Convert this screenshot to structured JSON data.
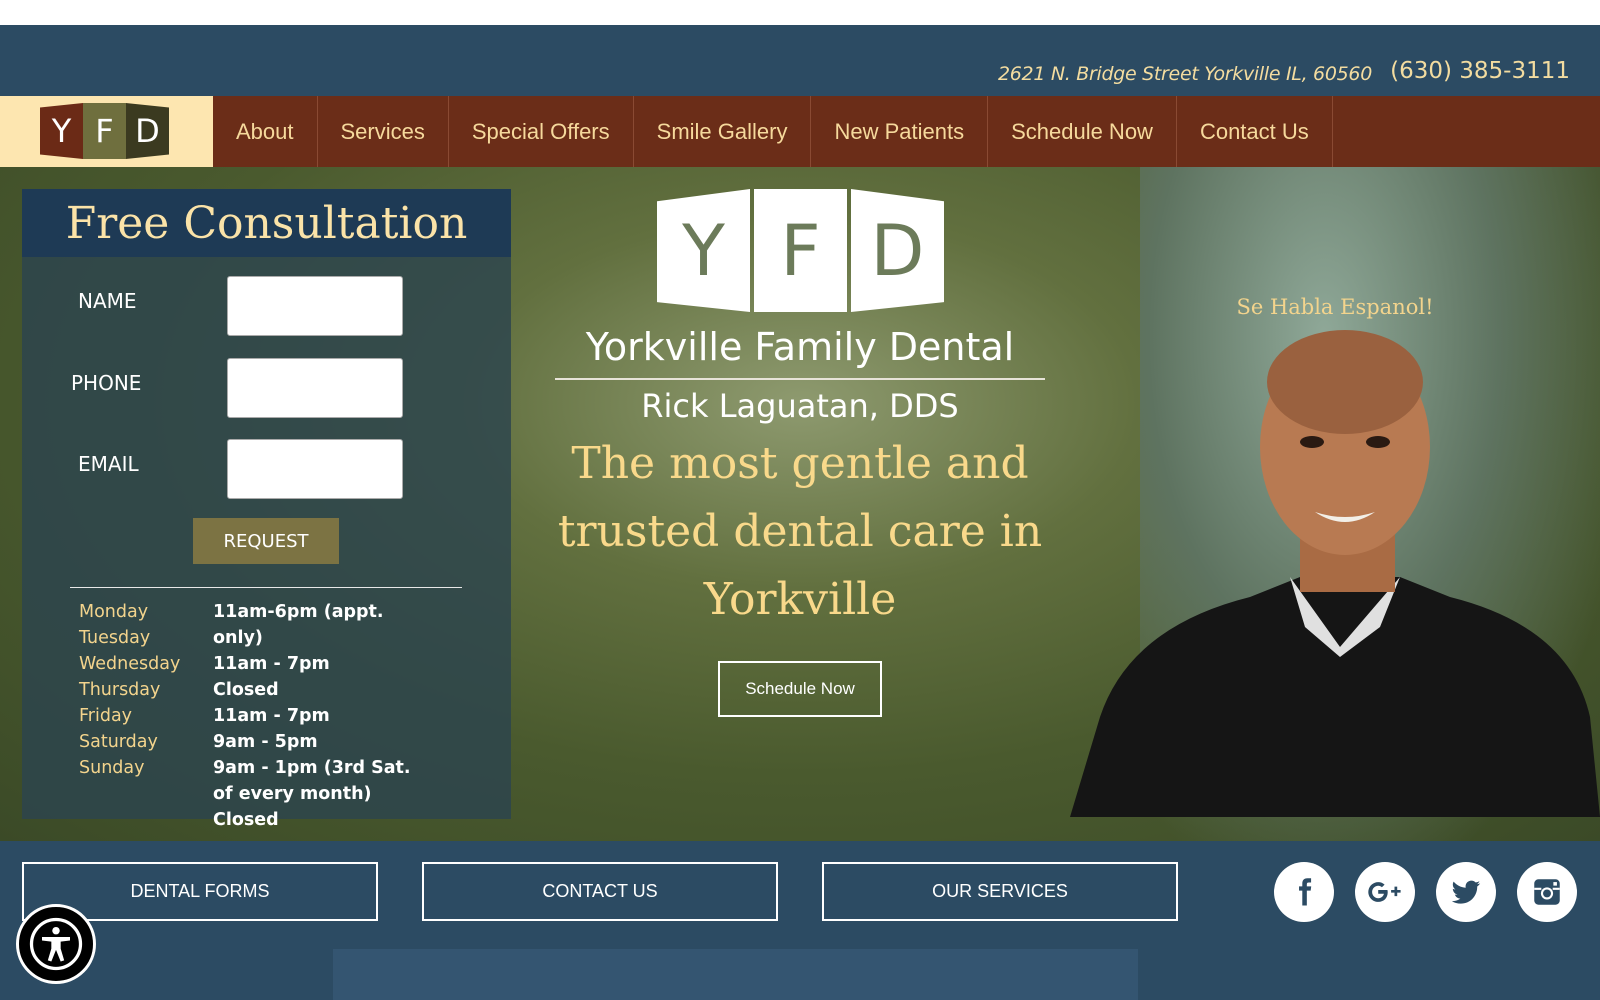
{
  "header": {
    "address": "2621 N. Bridge Street Yorkville IL, 60560",
    "phone": "(630) 385-3111"
  },
  "logo": {
    "letters": [
      "Y",
      "F",
      "D"
    ]
  },
  "nav": {
    "items": [
      {
        "label": "About"
      },
      {
        "label": "Services"
      },
      {
        "label": "Special Offers"
      },
      {
        "label": "Smile Gallery"
      },
      {
        "label": "New Patients"
      },
      {
        "label": "Schedule Now"
      },
      {
        "label": "Contact Us"
      }
    ]
  },
  "form": {
    "title": "Free Consultation",
    "name_label": "NAME",
    "phone_label": "PHONE",
    "email_label": "EMAIL",
    "name_value": "",
    "phone_value": "",
    "email_value": "",
    "submit_label": "REQUEST"
  },
  "hours": {
    "days": [
      "Monday",
      "Tuesday",
      "Wednesday",
      "Thursday",
      "Friday",
      "Saturday",
      "Sunday"
    ],
    "times": [
      "11am-6pm (appt. only)",
      "11am - 7pm",
      "Closed",
      "11am - 7pm",
      "9am - 5pm",
      "9am - 1pm (3rd Sat. of every month)",
      "Closed"
    ]
  },
  "hero": {
    "brand_letters": [
      "Y",
      "F",
      "D"
    ],
    "brand_name": "Yorkville Family Dental",
    "doctor": "Rick Laguatan, DDS",
    "tagline": "The most gentle and trusted dental care in Yorkville",
    "cta_label": "Schedule Now",
    "spanish_note": "Se Habla Espanol!"
  },
  "footer": {
    "buttons": [
      {
        "label": "DENTAL FORMS"
      },
      {
        "label": "CONTACT US"
      },
      {
        "label": "OUR SERVICES"
      }
    ],
    "social": [
      "facebook-icon",
      "google-plus-icon",
      "twitter-icon",
      "instagram-icon"
    ]
  },
  "colors": {
    "nav_bg": "#6b2d18",
    "header_bg": "#2c4b63",
    "accent_gold": "#f3d48d"
  }
}
